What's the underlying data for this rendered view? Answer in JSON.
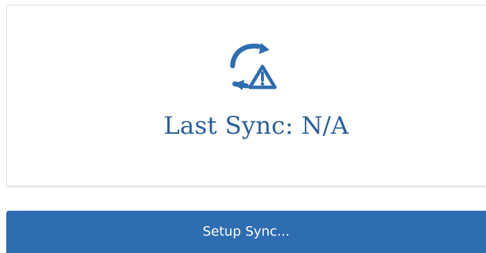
{
  "sync_card": {
    "status_text": "Last Sync: N/A",
    "icon_name": "sync-warning-icon"
  },
  "actions": {
    "setup_sync_label": "Setup Sync..."
  },
  "colors": {
    "accent": "#2e6db0",
    "text_blue": "#2a5f9b",
    "background": "#ffffff",
    "card_border": "#dddddd"
  }
}
